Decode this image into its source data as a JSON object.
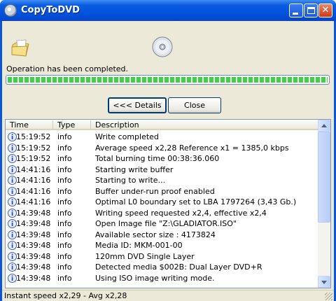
{
  "window": {
    "title": "CopyToDVD",
    "accent": "#0a56d8"
  },
  "icons": {
    "app": "disc-app-icon",
    "status": "folder-icon",
    "media": "cd-disc-icon"
  },
  "status": {
    "message": "Operation has been completed.",
    "progress_fraction": 1.0,
    "progress_color": "#3bd24a"
  },
  "buttons": {
    "details": "<<< Details",
    "close": "Close"
  },
  "log": {
    "columns": [
      "Time",
      "Type",
      "Description"
    ],
    "rows": [
      {
        "time": "15:19:52",
        "type": "info",
        "description": "Write completed"
      },
      {
        "time": "15:19:52",
        "type": "info",
        "description": "Average speed x2,28 Reference x1 = 1385,0 kbps"
      },
      {
        "time": "15:19:52",
        "type": "info",
        "description": "Total burning time 00:38:36.060"
      },
      {
        "time": "14:41:16",
        "type": "info",
        "description": "Starting write buffer"
      },
      {
        "time": "14:41:16",
        "type": "info",
        "description": "Starting to write..."
      },
      {
        "time": "14:41:16",
        "type": "info",
        "description": "Buffer under-run proof enabled"
      },
      {
        "time": "14:41:16",
        "type": "info",
        "description": "Optimal L0 boundary set to LBA 1797264 (3,43 Gb.)"
      },
      {
        "time": "14:39:48",
        "type": "info",
        "description": "Writing speed requested x2,4, effective x2,4"
      },
      {
        "time": "14:39:48",
        "type": "info",
        "description": "Open Image file \"Z:\\GLADIATOR.ISO\""
      },
      {
        "time": "14:39:48",
        "type": "info",
        "description": "Available sector size : 4173824"
      },
      {
        "time": "14:39:48",
        "type": "info",
        "description": "Media ID: MKM-001-00"
      },
      {
        "time": "14:39:48",
        "type": "info",
        "description": "120mm DVD Single Layer"
      },
      {
        "time": "14:39:48",
        "type": "info",
        "description": "Detected media $002B: Dual Layer DVD+R"
      },
      {
        "time": "14:39:48",
        "type": "info",
        "description": "Using ISO image writing mode."
      }
    ]
  },
  "statusbar": {
    "text": "Instant speed x2,29 - Avg x2,28"
  }
}
